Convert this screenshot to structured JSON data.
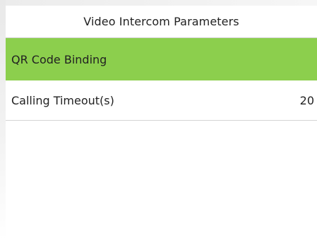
{
  "header": {
    "title": "Video Intercom Parameters"
  },
  "menu": {
    "items": [
      {
        "label": "QR Code Binding",
        "value": ""
      },
      {
        "label": "Calling Timeout(s)",
        "value": "20"
      }
    ]
  },
  "colors": {
    "selected_background": "#8ccf4d",
    "divider": "#d4d4d4"
  }
}
